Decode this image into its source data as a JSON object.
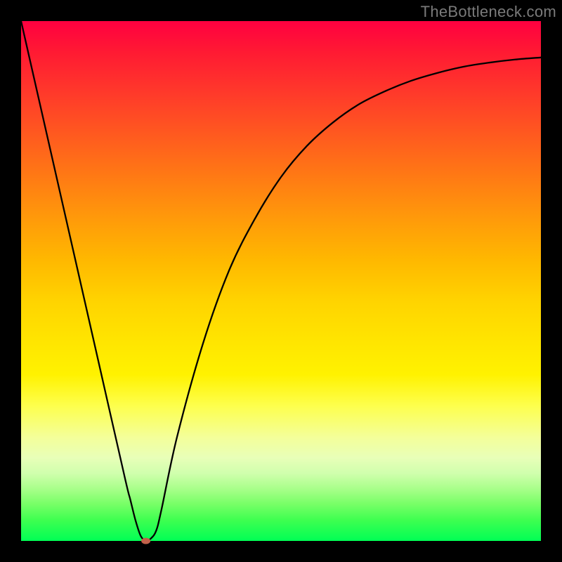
{
  "watermark": "TheBottleneck.com",
  "chart_data": {
    "type": "line",
    "title": "",
    "xlabel": "",
    "ylabel": "",
    "xlim": [
      0,
      100
    ],
    "ylim": [
      0,
      100
    ],
    "grid": false,
    "x": [
      0,
      5,
      10,
      15,
      20,
      21,
      22,
      23,
      24,
      25,
      26,
      27,
      30,
      35,
      40,
      45,
      50,
      55,
      60,
      65,
      70,
      75,
      80,
      85,
      90,
      95,
      100
    ],
    "values": [
      100,
      78,
      56,
      34,
      12,
      8,
      4,
      1,
      0,
      0.5,
      2,
      6,
      20,
      38,
      52,
      62,
      70,
      76,
      80.5,
      84,
      86.5,
      88.5,
      90,
      91.2,
      92,
      92.6,
      93
    ],
    "marker": {
      "x": 24,
      "y": 0,
      "rx": 6,
      "ry": 4,
      "color": "#c1614a"
    },
    "background": "rainbow-vertical"
  }
}
